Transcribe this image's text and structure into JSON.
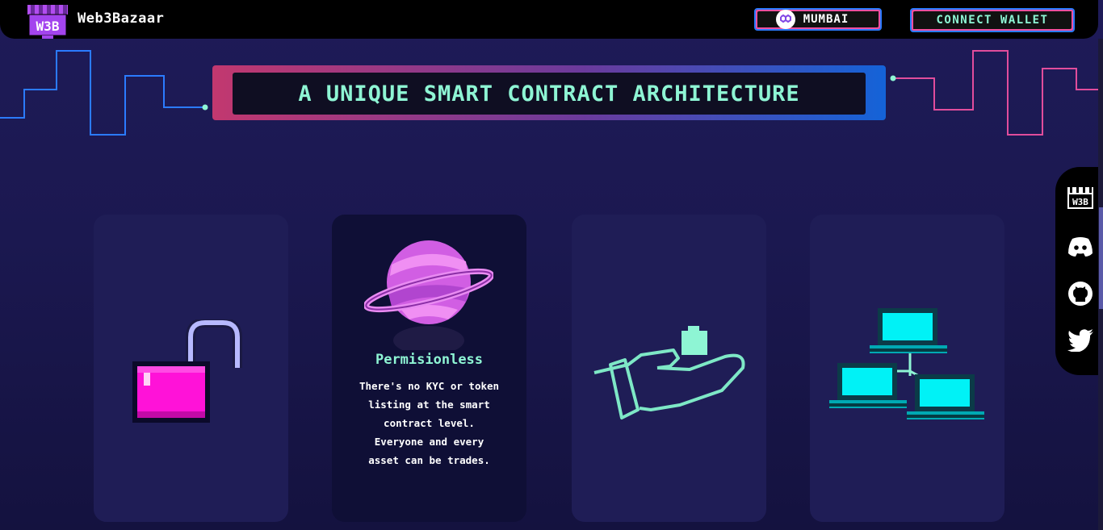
{
  "header": {
    "brand": "Web3Bazaar",
    "logo_text": "W3B",
    "network_label": "MUMBAI",
    "wallet_label": "CONNECT WALLET"
  },
  "hero": {
    "title": "A UNIQUE SMART CONTRACT ARCHITECTURE"
  },
  "cards": [
    {
      "icon": "unlocked-padlock-icon",
      "title": "",
      "desc": []
    },
    {
      "icon": "planet-icon",
      "title": "Permisionless",
      "desc": [
        "There's no KYC or token",
        "listing at the smart",
        "contract level.",
        "Everyone and every",
        "asset can be trades."
      ]
    },
    {
      "icon": "hand-holding-icon",
      "title": "",
      "desc": []
    },
    {
      "icon": "network-computers-icon",
      "title": "",
      "desc": []
    }
  ],
  "social": [
    "w3b-logo-icon",
    "discord-icon",
    "github-icon",
    "twitter-icon"
  ],
  "colors": {
    "accent_mint": "#8ef5d4",
    "accent_pink": "#f04fa0",
    "accent_blue": "#2b7bff",
    "background": "#1e1b58"
  }
}
